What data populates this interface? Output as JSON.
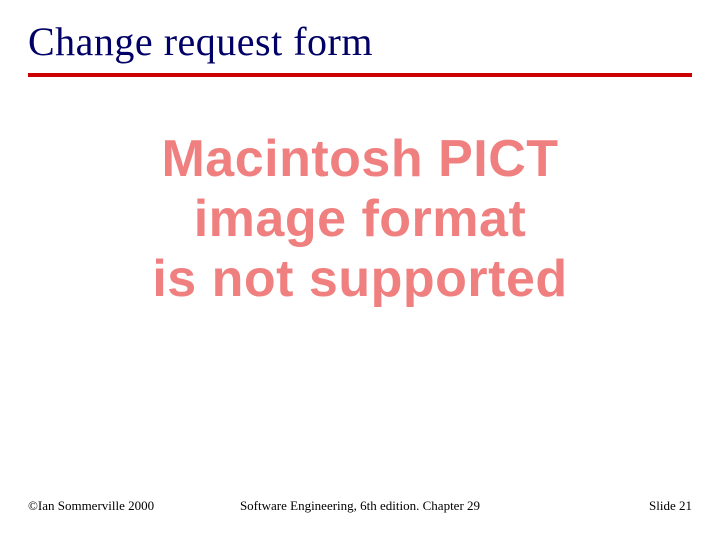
{
  "title": "Change request form",
  "error": {
    "line1": "Macintosh PICT",
    "line2": "image format",
    "line3": "is not supported"
  },
  "footer": {
    "left": "©Ian Sommerville 2000",
    "center": "Software Engineering, 6th edition. Chapter 29",
    "right": "Slide 21"
  }
}
